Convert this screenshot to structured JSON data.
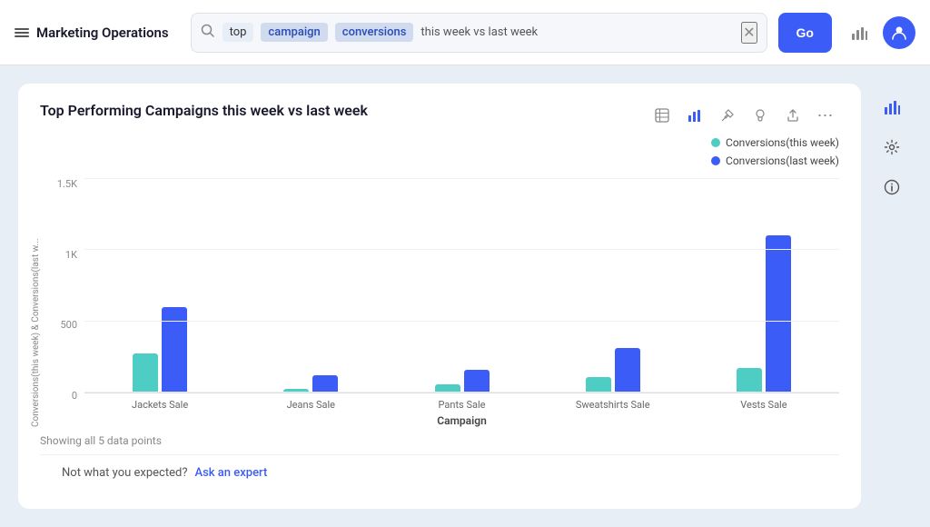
{
  "header": {
    "brand": "Marketing Operations",
    "search": {
      "tag1": "top",
      "tag2": "campaign",
      "tag3": "conversions",
      "query": "this week vs last week",
      "go_label": "Go"
    }
  },
  "chart": {
    "title": "Top Performing Campaigns this week vs last week",
    "legend": [
      {
        "id": "this_week",
        "label": "Conversions(this week)",
        "color": "#4ecdc4"
      },
      {
        "id": "last_week",
        "label": "Conversions(last week)",
        "color": "#3b5cf6"
      }
    ],
    "y_axis": {
      "title": "Conversions(this week) & Conversions(last w...",
      "ticks": [
        "1.5K",
        "",
        "1K",
        "",
        "500",
        "",
        "0"
      ]
    },
    "x_axis_title": "Campaign",
    "groups": [
      {
        "label": "Jackets Sale",
        "this_week": 290,
        "last_week": 640
      },
      {
        "label": "Jeans Sale",
        "this_week": 30,
        "last_week": 130
      },
      {
        "label": "Pants Sale",
        "this_week": 60,
        "last_week": 170
      },
      {
        "label": "Sweatshirts Sale",
        "this_week": 115,
        "last_week": 335
      },
      {
        "label": "Vests Sale",
        "this_week": 185,
        "last_week": 1180
      }
    ],
    "max_value": 1500,
    "data_info": "Showing all 5 data points"
  },
  "feedback": {
    "label": "Not what you expected?",
    "link": "Ask an expert"
  },
  "toolbar": {
    "icons": [
      "⊟",
      "📊",
      "📌",
      "💡",
      "⬆",
      "⋯"
    ]
  },
  "sidebar": {
    "icons": [
      "📊",
      "⚙",
      "ℹ"
    ]
  }
}
